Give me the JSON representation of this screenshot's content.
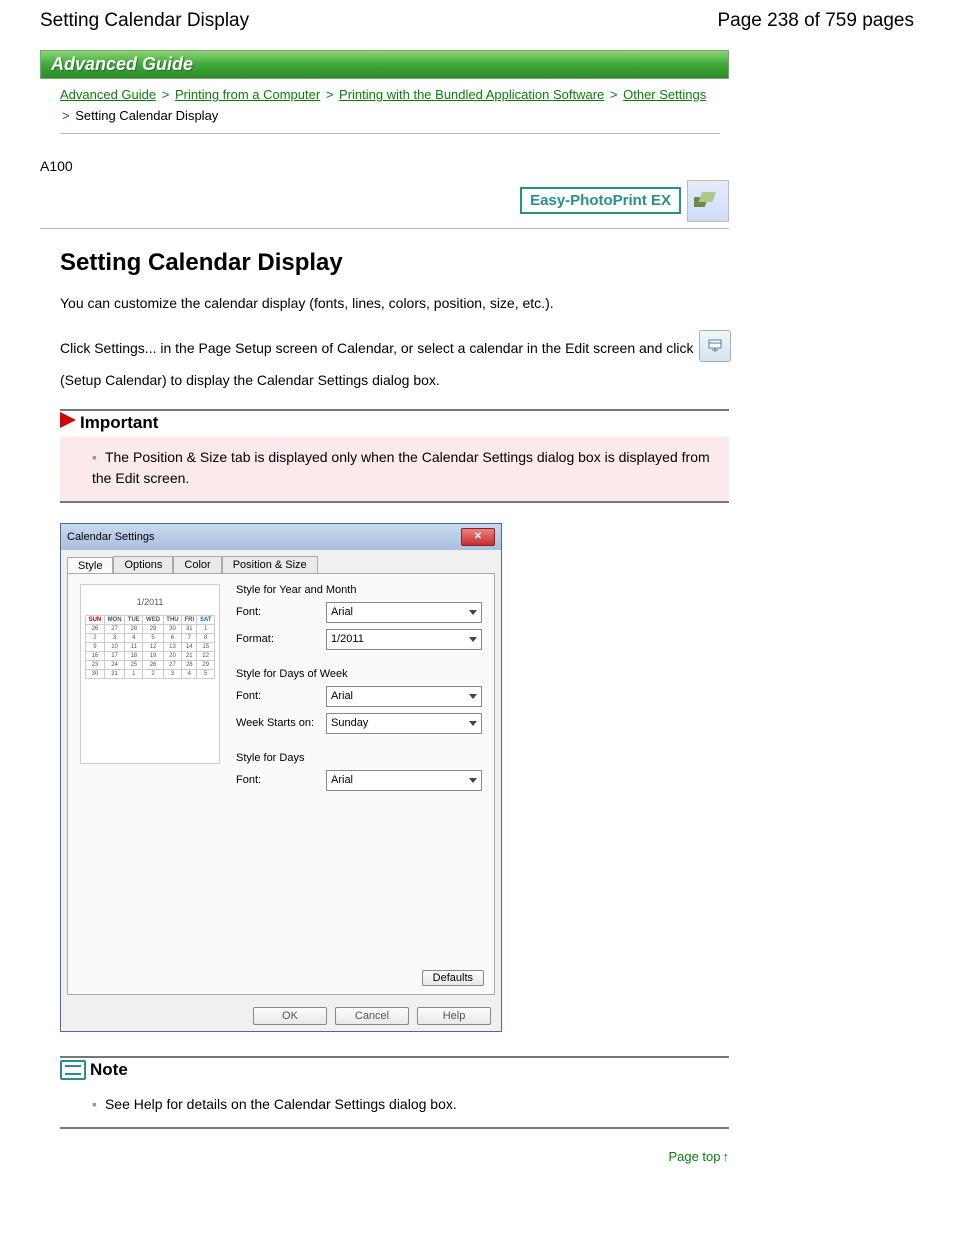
{
  "header": {
    "title": "Setting Calendar Display",
    "pagenum": "Page 238 of 759 pages"
  },
  "banner": "Advanced Guide",
  "breadcrumb": {
    "items": [
      "Advanced Guide",
      "Printing from a Computer",
      "Printing with the Bundled Application Software",
      "Other Settings"
    ],
    "current": "Setting Calendar Display"
  },
  "doc_code": "A100",
  "app_badge": "Easy-PhotoPrint EX",
  "h1": "Setting Calendar Display",
  "p1": "You can customize the calendar display (fonts, lines, colors, position, size, etc.).",
  "p2a": "Click Settings... in the Page Setup screen of Calendar, or select a calendar in the Edit screen and click",
  "p2b": "(Setup Calendar) to display the Calendar Settings dialog box.",
  "important": {
    "title": "Important",
    "body": "The Position & Size tab is displayed only when the Calendar Settings dialog box is displayed from the Edit screen."
  },
  "note": {
    "title": "Note",
    "body": "See Help for details on the Calendar Settings dialog box."
  },
  "page_top": "Page top",
  "dialog": {
    "title": "Calendar Settings",
    "tabs": [
      "Style",
      "Options",
      "Color",
      "Position & Size"
    ],
    "preview_month": "1/2011",
    "groups": {
      "ym": {
        "title": "Style for Year and Month",
        "font_label": "Font:",
        "font_value": "Arial",
        "format_label": "Format:",
        "format_value": "1/2011"
      },
      "dow": {
        "title": "Style for Days of Week",
        "font_label": "Font:",
        "font_value": "Arial",
        "week_label": "Week Starts on:",
        "week_value": "Sunday"
      },
      "days": {
        "title": "Style for Days",
        "font_label": "Font:",
        "font_value": "Arial"
      }
    },
    "defaults": "Defaults",
    "ok": "OK",
    "cancel": "Cancel",
    "help": "Help"
  },
  "chart_data": {
    "type": "table",
    "title": "1/2011",
    "columns": [
      "SUN",
      "MON",
      "TUE",
      "WED",
      "THU",
      "FRI",
      "SAT"
    ],
    "rows": [
      [
        "26",
        "27",
        "28",
        "29",
        "30",
        "31",
        "1"
      ],
      [
        "2",
        "3",
        "4",
        "5",
        "6",
        "7",
        "8"
      ],
      [
        "9",
        "10",
        "11",
        "12",
        "13",
        "14",
        "15"
      ],
      [
        "16",
        "17",
        "18",
        "19",
        "20",
        "21",
        "22"
      ],
      [
        "23",
        "24",
        "25",
        "26",
        "27",
        "28",
        "29"
      ],
      [
        "30",
        "31",
        "1",
        "2",
        "3",
        "4",
        "5"
      ]
    ]
  }
}
